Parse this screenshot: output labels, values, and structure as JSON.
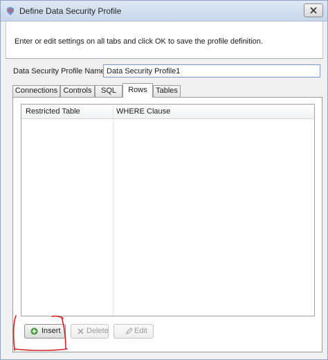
{
  "window": {
    "title": "Define Data Security Profile"
  },
  "header": {
    "instruction": "Enter or edit settings on all tabs and click OK to save the profile definition."
  },
  "form": {
    "name_label": "Data Security Profile Name",
    "name_value": "Data Security Profile1"
  },
  "tabs": [
    {
      "label": "Connections",
      "active": false
    },
    {
      "label": "Controls",
      "active": false
    },
    {
      "label": "SQL",
      "active": false
    },
    {
      "label": "Rows",
      "active": true
    },
    {
      "label": "Tables",
      "active": false
    }
  ],
  "rows_grid": {
    "columns": [
      "Restricted Table",
      "WHERE Clause"
    ],
    "rows": []
  },
  "buttons": {
    "insert": "Insert",
    "delete": "Delete",
    "edit": "Edit"
  },
  "colors": {
    "insert_icon": "#3a9a2a",
    "annotation": "#d42020"
  }
}
